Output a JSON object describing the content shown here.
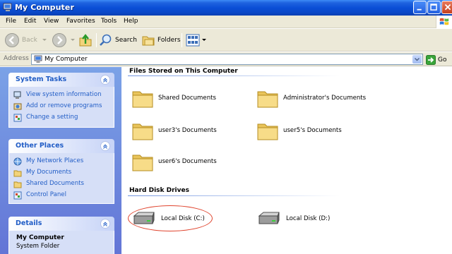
{
  "window": {
    "title": "My Computer"
  },
  "menu": [
    "File",
    "Edit",
    "View",
    "Favorites",
    "Tools",
    "Help"
  ],
  "toolbar": {
    "back": "Back",
    "search": "Search",
    "folders": "Folders"
  },
  "address": {
    "label": "Address",
    "value": "My Computer",
    "go": "Go"
  },
  "tasks": {
    "system": {
      "title": "System Tasks",
      "items": [
        {
          "label": "View system information",
          "icon": "system-info-icon"
        },
        {
          "label": "Add or remove programs",
          "icon": "add-remove-icon"
        },
        {
          "label": "Change a setting",
          "icon": "control-panel-icon"
        }
      ]
    },
    "other": {
      "title": "Other Places",
      "items": [
        {
          "label": "My Network Places",
          "icon": "network-places-icon"
        },
        {
          "label": "My Documents",
          "icon": "folder-icon"
        },
        {
          "label": "Shared Documents",
          "icon": "folder-icon"
        },
        {
          "label": "Control Panel",
          "icon": "control-panel-icon"
        }
      ]
    },
    "details": {
      "title": "Details",
      "name": "My Computer",
      "type": "System Folder"
    }
  },
  "files": {
    "title": "Files Stored on This Computer",
    "items": [
      "Shared Documents",
      "Administrator's Documents",
      "user3's Documents",
      "user5's Documents",
      "user6's Documents"
    ]
  },
  "drives": {
    "title": "Hard Disk Drives",
    "items": [
      "Local Disk (C:)",
      "Local Disk (D:)"
    ]
  },
  "colors": {
    "titlebar": "#0a4fd6",
    "taskpane": "#7ba2e7",
    "link": "#215dc6",
    "highlight": "#e0442e"
  }
}
